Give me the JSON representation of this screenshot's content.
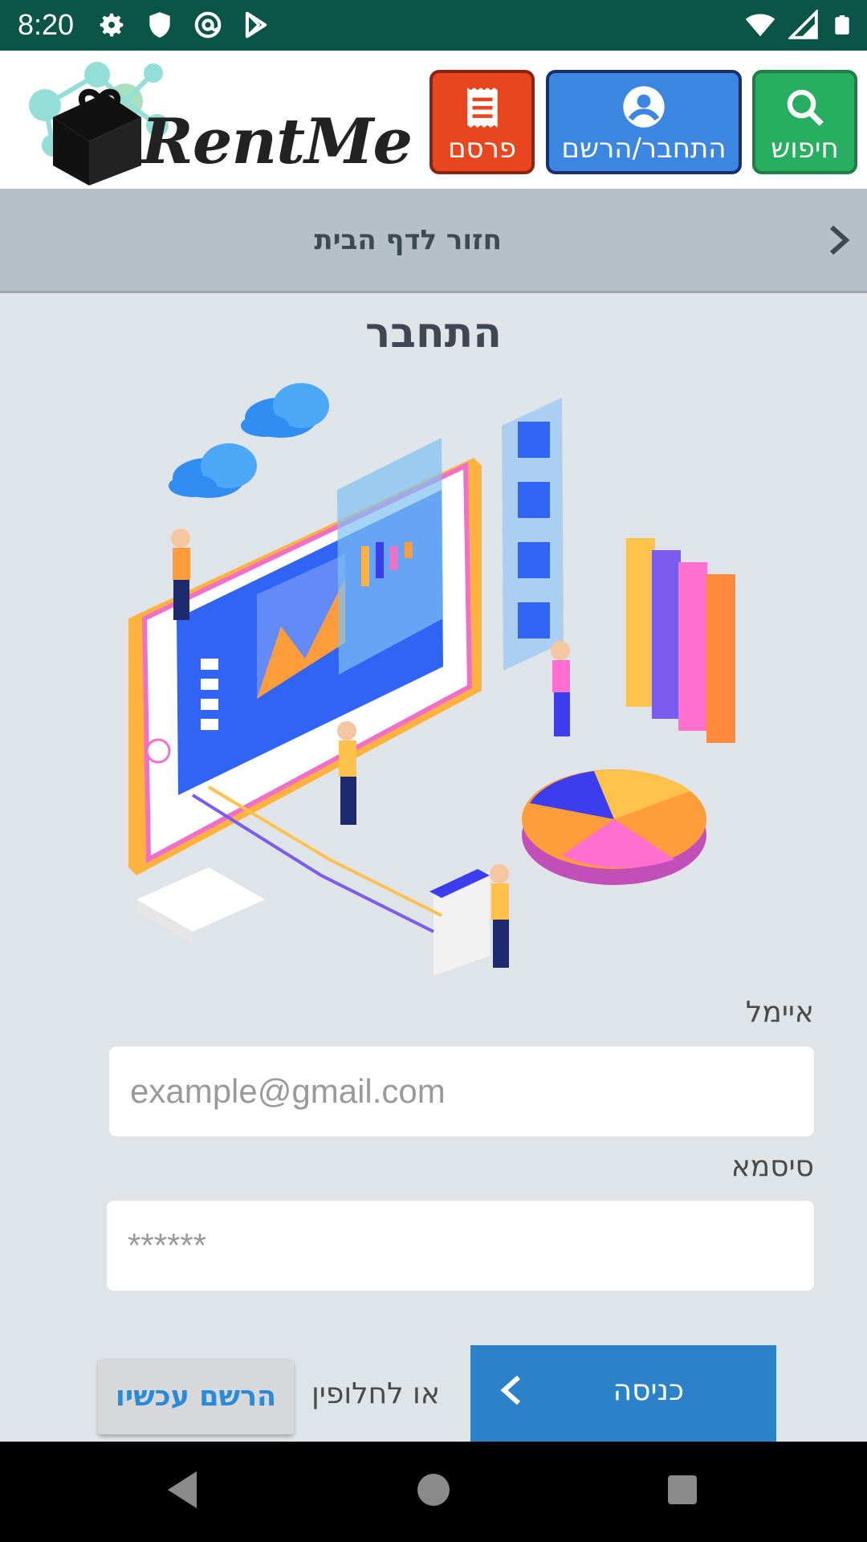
{
  "status_bar": {
    "time": "8:20",
    "left_icons": [
      "gear-icon",
      "shield-icon",
      "at-sign-icon",
      "play-store-icon"
    ],
    "right_icons": [
      "wifi-icon",
      "signal-icon",
      "battery-icon"
    ]
  },
  "header": {
    "logo_text": "RentMe",
    "buttons": {
      "search": "חיפוש",
      "login_register": "התחבר/הרשם",
      "publish": "פרסם"
    },
    "colors": {
      "search": "#27ae60",
      "login": "#3a86e0",
      "publish": "#e8461f"
    }
  },
  "back_bar": {
    "label": "חזור לדף הבית"
  },
  "page": {
    "title": "התחבר"
  },
  "form": {
    "email_label": "איימל",
    "email_placeholder": "example@gmail.com",
    "password_label": "סיסמא",
    "password_placeholder": "******",
    "enter_button": "כניסה",
    "or_text": "או לחלופין",
    "register_button": "הרשם עכשיו"
  },
  "nav_bar": {
    "buttons": [
      "back-icon",
      "home-icon",
      "recents-icon"
    ]
  }
}
